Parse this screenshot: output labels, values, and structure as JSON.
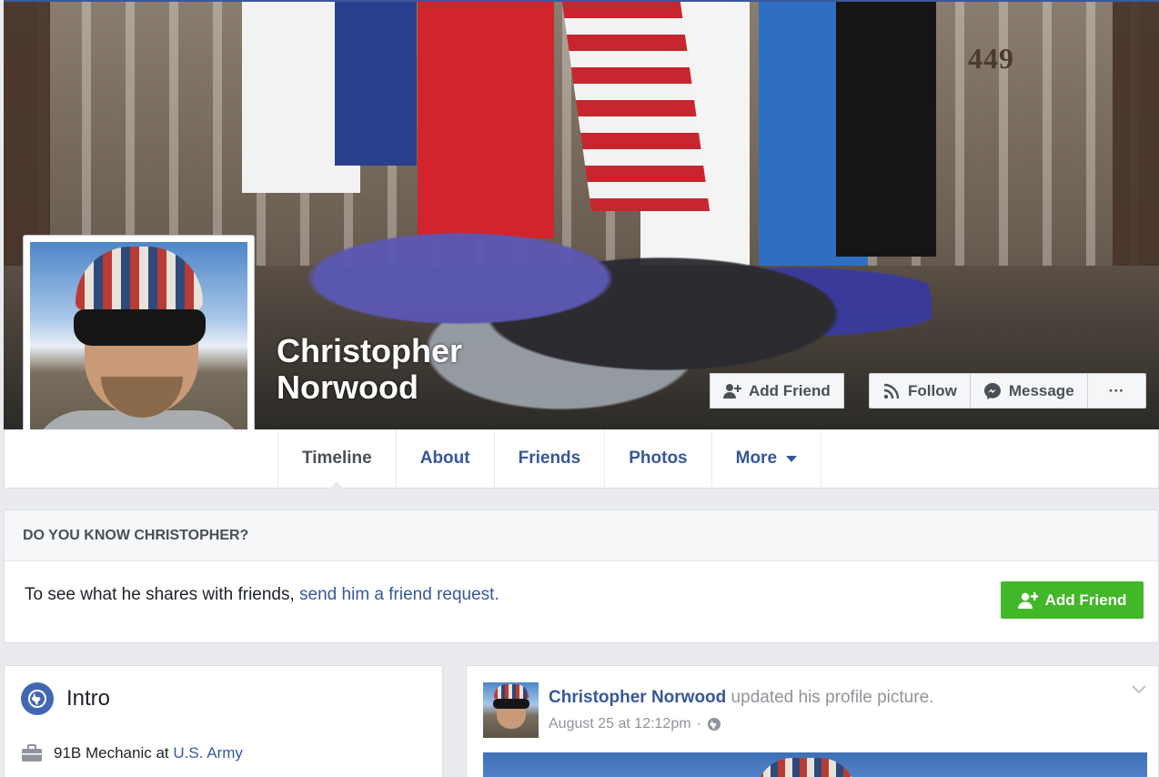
{
  "profile": {
    "name": "Christopher Norwood",
    "cover_house_number": "449"
  },
  "cover_actions": {
    "add_friend": "Add Friend",
    "follow": "Follow",
    "message": "Message",
    "more": "···"
  },
  "tabs": [
    {
      "label": "Timeline",
      "active": true
    },
    {
      "label": "About"
    },
    {
      "label": "Friends"
    },
    {
      "label": "Photos"
    },
    {
      "label": "More"
    }
  ],
  "know_box": {
    "heading": "DO YOU KNOW CHRISTOPHER?",
    "text": "To see what he shares with friends, ",
    "link": "send him a friend request.",
    "button": "Add Friend"
  },
  "intro": {
    "title": "Intro",
    "work_prefix": "91B Mechanic at ",
    "work_link": "U.S. Army"
  },
  "post": {
    "author": "Christopher Norwood",
    "action": " updated his profile picture.",
    "timestamp": "August 25 at 12:12pm",
    "separator": "·"
  },
  "colors": {
    "link_blue": "#365899",
    "green_button": "#42b72a",
    "background": "#e9ebee"
  }
}
